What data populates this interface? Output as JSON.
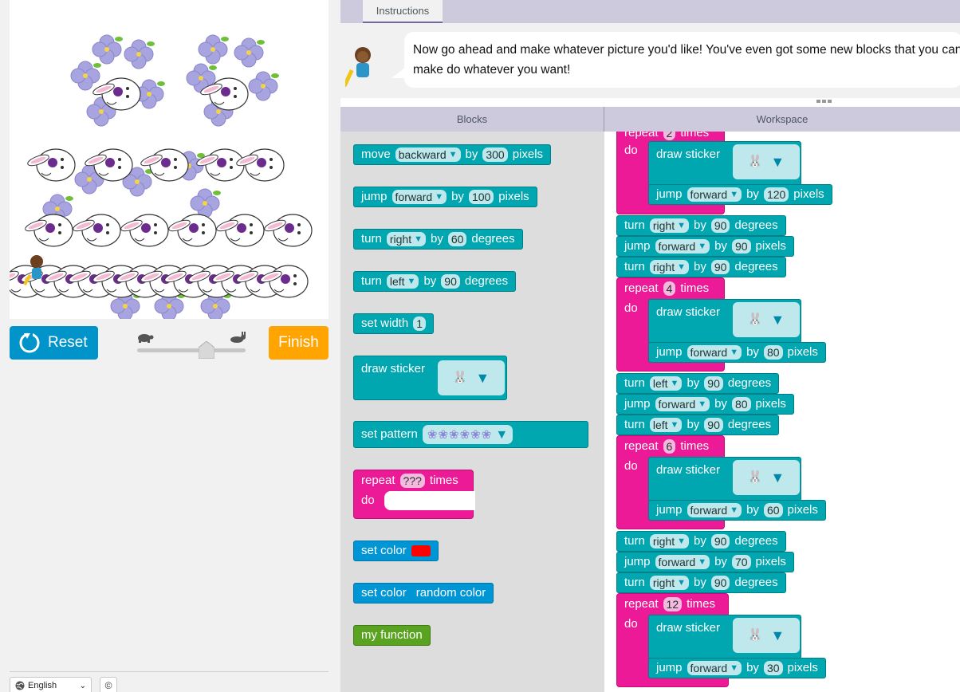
{
  "instructions": {
    "tab_label": "Instructions",
    "message": "Now go ahead and make whatever picture you'd like! You've even got some new blocks that you can make do whatever you want!"
  },
  "controls": {
    "reset_label": "Reset",
    "finish_label": "Finish",
    "slow_icon": "turtle-icon",
    "fast_icon": "rabbit-icon",
    "speed_level": 0.62
  },
  "footer": {
    "language": "English",
    "copyright_symbol": "©"
  },
  "headers": {
    "blocks": "Blocks",
    "workspace": "Workspace"
  },
  "toolbox": {
    "move_backward": {
      "verb": "move",
      "dir": "backward",
      "by": "by",
      "value": "300",
      "unit": "pixels"
    },
    "jump_forward": {
      "verb": "jump",
      "dir": "forward",
      "by": "by",
      "value": "100",
      "unit": "pixels"
    },
    "turn_right": {
      "verb": "turn",
      "dir": "right",
      "by": "by",
      "value": "60",
      "unit": "degrees"
    },
    "turn_left": {
      "verb": "turn",
      "dir": "left",
      "by": "by",
      "value": "90",
      "unit": "degrees"
    },
    "set_width": {
      "label": "set width",
      "value": "1"
    },
    "draw_sticker": {
      "label": "draw sticker"
    },
    "set_pattern": {
      "label": "set pattern"
    },
    "repeat": {
      "label": "repeat",
      "value": "???",
      "times": "times",
      "do": "do"
    },
    "set_color": {
      "label": "set color",
      "color": "#ff0000"
    },
    "set_random_color": {
      "label": "set color",
      "value": "random color"
    },
    "my_function": {
      "label": "my function"
    }
  },
  "workspace": {
    "top_repeat": {
      "label": "repeat",
      "value": "2",
      "times": "times",
      "do": "do",
      "sticker": "draw sticker",
      "jump": {
        "verb": "jump",
        "dir": "forward",
        "by": "by",
        "value": "120",
        "unit": "pixels"
      }
    },
    "seq1": [
      {
        "verb": "turn",
        "dir": "right",
        "by": "by",
        "value": "90",
        "unit": "degrees"
      },
      {
        "verb": "jump",
        "dir": "forward",
        "by": "by",
        "value": "90",
        "unit": "pixels"
      },
      {
        "verb": "turn",
        "dir": "right",
        "by": "by",
        "value": "90",
        "unit": "degrees"
      }
    ],
    "repeat2": {
      "label": "repeat",
      "value": "4",
      "times": "times",
      "do": "do",
      "sticker": "draw sticker",
      "jump": {
        "verb": "jump",
        "dir": "forward",
        "by": "by",
        "value": "80",
        "unit": "pixels"
      }
    },
    "seq2": [
      {
        "verb": "turn",
        "dir": "left",
        "by": "by",
        "value": "90",
        "unit": "degrees"
      },
      {
        "verb": "jump",
        "dir": "forward",
        "by": "by",
        "value": "80",
        "unit": "pixels"
      },
      {
        "verb": "turn",
        "dir": "left",
        "by": "by",
        "value": "90",
        "unit": "degrees"
      }
    ],
    "repeat3": {
      "label": "repeat",
      "value": "6",
      "times": "times",
      "do": "do",
      "sticker": "draw sticker",
      "jump": {
        "verb": "jump",
        "dir": "forward",
        "by": "by",
        "value": "60",
        "unit": "pixels"
      }
    },
    "seq3": [
      {
        "verb": "turn",
        "dir": "right",
        "by": "by",
        "value": "90",
        "unit": "degrees"
      },
      {
        "verb": "jump",
        "dir": "forward",
        "by": "by",
        "value": "70",
        "unit": "pixels"
      },
      {
        "verb": "turn",
        "dir": "right",
        "by": "by",
        "value": "90",
        "unit": "degrees"
      }
    ],
    "repeat4": {
      "label": "repeat",
      "value": "12",
      "times": "times",
      "do": "do",
      "sticker": "draw sticker",
      "jump": {
        "verb": "jump",
        "dir": "forward",
        "by": "by",
        "value": "30",
        "unit": "pixels"
      }
    }
  },
  "colors": {
    "motion_block": "#00a6b0",
    "loop_block": "#ec1a96",
    "color_block": "#0096d6",
    "function_block": "#59a321",
    "reset_button": "#0094ca",
    "finish_button": "#ffa400"
  }
}
